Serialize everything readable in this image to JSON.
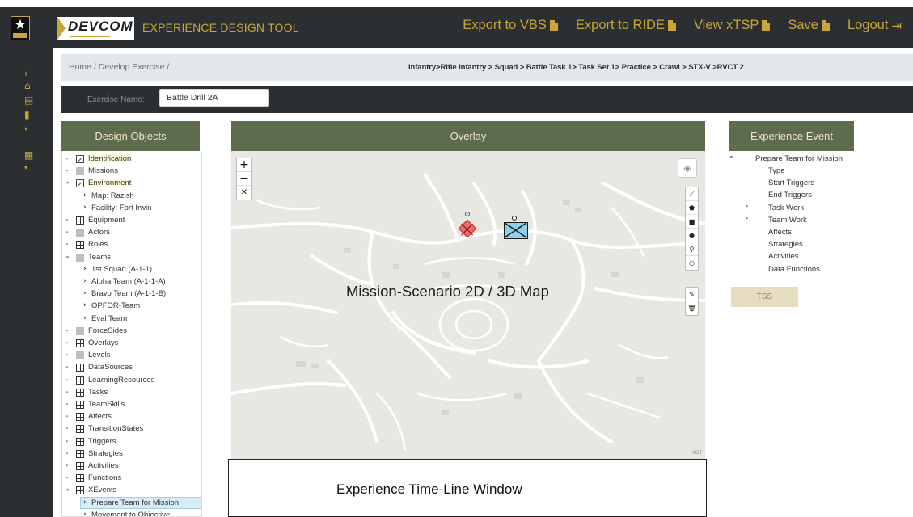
{
  "header": {
    "app_title": "EXPERIENCE DESIGN TOOL",
    "logo_text": "DEVCOM",
    "nav": [
      {
        "label": "Export to VBS",
        "icon": "document-icon"
      },
      {
        "label": "Export to RIDE",
        "icon": "document-icon"
      },
      {
        "label": "View xTSP",
        "icon": "document-icon"
      },
      {
        "label": "Save",
        "icon": "document-icon"
      },
      {
        "label": "Logout",
        "icon": "logout-icon"
      }
    ],
    "accent": "#c9a63b",
    "bg": "#2b2f31"
  },
  "sidebar": {
    "icons": [
      "chevron-right-icon",
      "home-icon",
      "layers-icon",
      "document-icon",
      "caret-down-icon",
      "map-icon",
      "caret-down-icon"
    ]
  },
  "breadcrumb": {
    "text": "Home  /  Develop Exercise  /",
    "path": "Infantry>Rifle Infantry > Squad > Battle Task 1> Task Set 1> Practice > Crawl > STX-V >RVCT 2"
  },
  "exercise": {
    "label": "Exercise Name:",
    "value": "Battle Drill 2A"
  },
  "design_objects": {
    "title": "Design Objects",
    "items": [
      {
        "label": "Identification",
        "icon": "edit",
        "toggle": "▸",
        "highlight": true
      },
      {
        "label": "Missions",
        "icon": "gray",
        "toggle": "▸"
      },
      {
        "label": "Environment",
        "icon": "edit",
        "toggle": "◂",
        "highlight": true
      },
      {
        "label": "Map: Razish",
        "child": true
      },
      {
        "label": "Facility: Fort Irwin",
        "child": true
      },
      {
        "label": "Equipment",
        "icon": "grid",
        "toggle": "▸"
      },
      {
        "label": "Actors",
        "icon": "gray",
        "toggle": "▸"
      },
      {
        "label": "Roles",
        "icon": "grid",
        "toggle": "▸"
      },
      {
        "label": "Teams",
        "icon": "gray",
        "toggle": "◂"
      },
      {
        "label": "1st Squad (A-1-1)",
        "child": true
      },
      {
        "label": "Alpha Team (A-1-1-A)",
        "child": true
      },
      {
        "label": "Bravo Team (A-1-1-B)",
        "child": true
      },
      {
        "label": "OPFOR-Team",
        "child": true
      },
      {
        "label": "Eval Team",
        "child": true
      },
      {
        "label": "ForceSides",
        "icon": "gray",
        "toggle": "▸"
      },
      {
        "label": "Overlays",
        "icon": "grid",
        "toggle": "▸"
      },
      {
        "label": "Levels",
        "icon": "gray",
        "toggle": "▸"
      },
      {
        "label": "DataSources",
        "icon": "grid",
        "toggle": "▸"
      },
      {
        "label": "LearningResources",
        "icon": "grid",
        "toggle": "▸"
      },
      {
        "label": "Tasks",
        "icon": "grid",
        "toggle": "▸"
      },
      {
        "label": "TeamSkills",
        "icon": "grid",
        "toggle": "▸"
      },
      {
        "label": "Affects",
        "icon": "grid",
        "toggle": "▸"
      },
      {
        "label": "TransitionStates",
        "icon": "grid",
        "toggle": "▸"
      },
      {
        "label": "Triggers",
        "icon": "grid",
        "toggle": "▸"
      },
      {
        "label": "Strategies",
        "icon": "grid",
        "toggle": "▸"
      },
      {
        "label": "Activities",
        "icon": "grid",
        "toggle": "▸"
      },
      {
        "label": "Functions",
        "icon": "grid",
        "toggle": "▸"
      },
      {
        "label": "XEvents",
        "icon": "grid",
        "toggle": "◂"
      },
      {
        "label": "Prepare Team for Mission",
        "child": true,
        "selected": true
      },
      {
        "label": "Movement to Objective",
        "child": true
      }
    ]
  },
  "overlay": {
    "title": "Overlay",
    "map_label": "Mission-Scenario 2D / 3D Map",
    "attribution": "XDT",
    "zoom": [
      "+",
      "−",
      "✕"
    ],
    "draw_tools": [
      "⟋",
      "⬟",
      "■",
      "●",
      "⚲",
      "○"
    ],
    "edit_tools": [
      "✎",
      "🗑"
    ]
  },
  "timeline": {
    "label": "Experience Time-Line Window"
  },
  "experience_event": {
    "title": "Experience Event",
    "root": "Prepare Team for Mission",
    "items": [
      {
        "label": "Type"
      },
      {
        "label": "Start Triggers"
      },
      {
        "label": "End Triggers"
      },
      {
        "label": "Task Work",
        "toggle": "▸"
      },
      {
        "label": "Team Work",
        "toggle": "▸"
      },
      {
        "label": "Affects"
      },
      {
        "label": "Strategies"
      },
      {
        "label": "Activities"
      },
      {
        "label": "Data Functions"
      }
    ],
    "button": "TSS"
  }
}
